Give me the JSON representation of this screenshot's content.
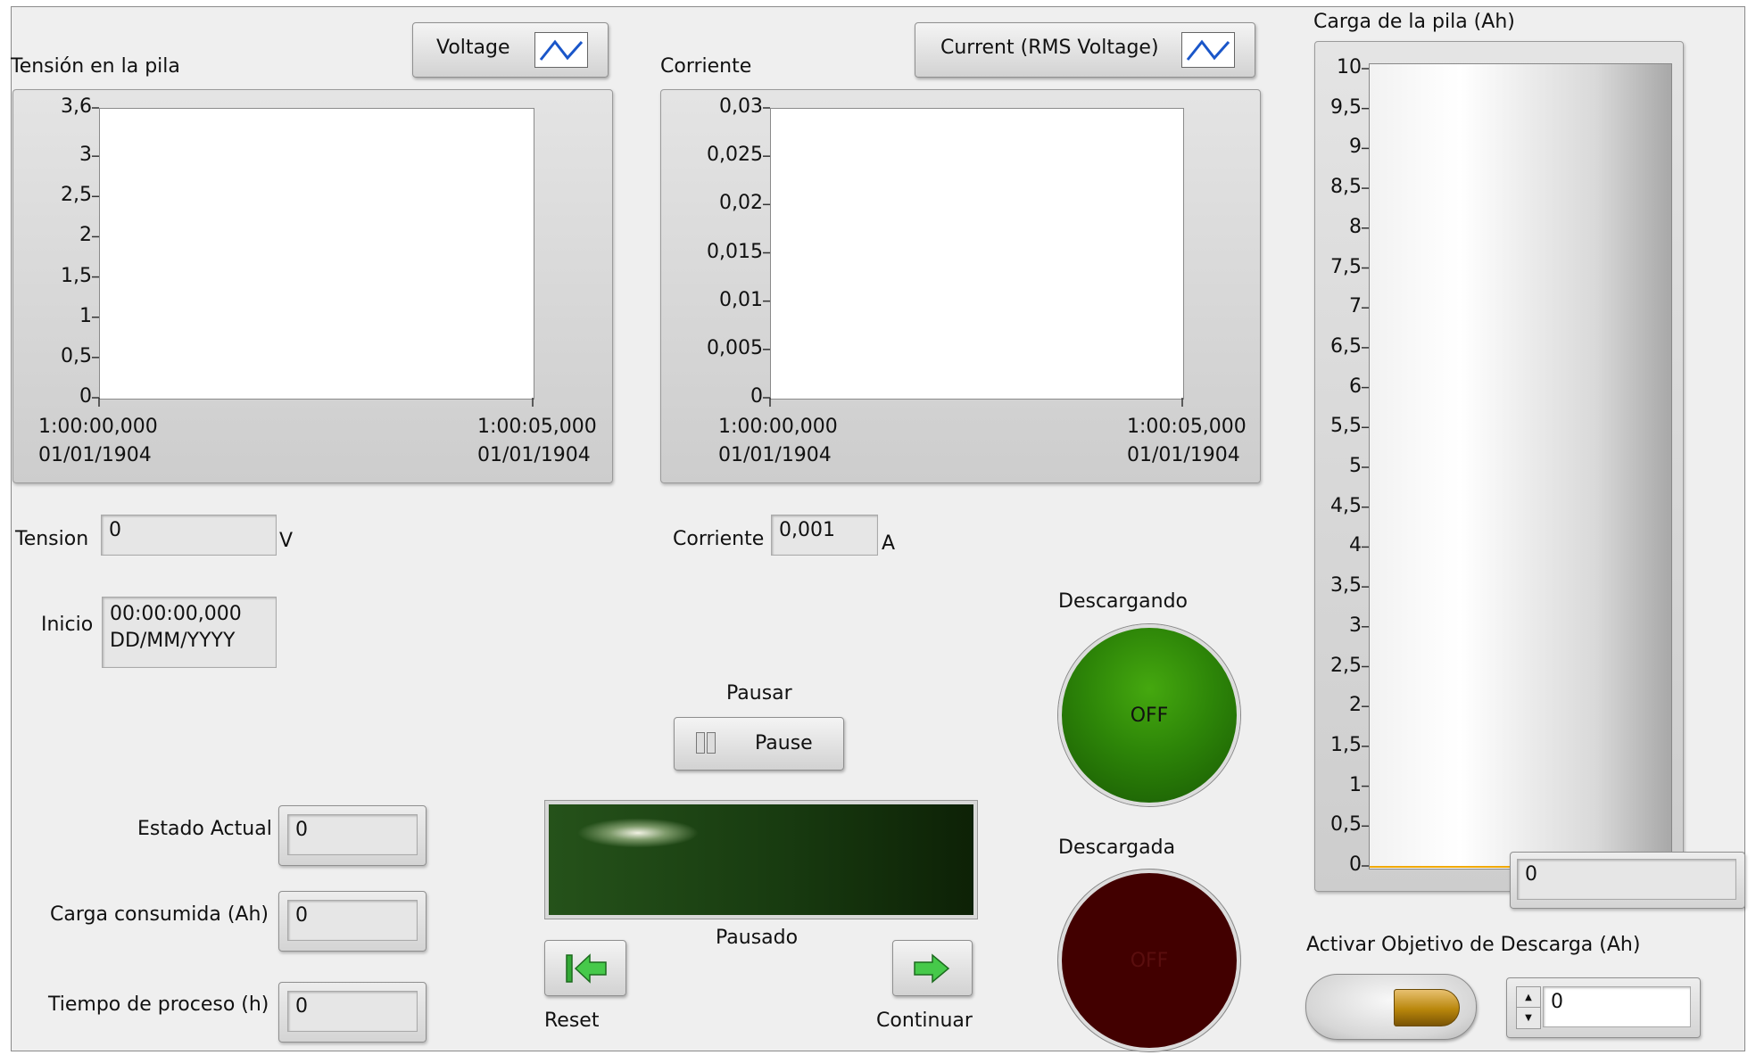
{
  "colors": {
    "panel": "#efefef",
    "led_green": "#2f8f0b",
    "led_red": "#420000",
    "bar_fill": "#f0a800",
    "display_dark": "#1c3a10"
  },
  "voltage_graph": {
    "title": "Tensión en la pila",
    "legend_label": "Voltage",
    "legend_icon": "waveform-icon",
    "y_ticks": [
      "3,6",
      "3",
      "2,5",
      "2",
      "1,5",
      "1",
      "0,5",
      "0"
    ],
    "x_start": "1:00:00,000\n01/01/1904",
    "x_end": "1:00:05,000\n01/01/1904"
  },
  "current_graph": {
    "title": "Corriente",
    "legend_label": "Current (RMS Voltage)",
    "legend_icon": "waveform-icon",
    "y_ticks": [
      "0,03",
      "0,025",
      "0,02",
      "0,015",
      "0,01",
      "0,005",
      "0"
    ],
    "x_start": "1:00:00,000\n01/01/1904",
    "x_end": "1:00:05,000\n01/01/1904"
  },
  "charge_bar": {
    "title": "Carga de la pila (Ah)",
    "ticks": [
      "10",
      "9,5",
      "9",
      "8,5",
      "8",
      "7,5",
      "7",
      "6,5",
      "6",
      "5,5",
      "5",
      "4,5",
      "4",
      "3,5",
      "3",
      "2,5",
      "2",
      "1,5",
      "1",
      "0,5",
      "0"
    ],
    "value": 0,
    "display": "0"
  },
  "tension": {
    "label": "Tension",
    "value": "0",
    "unit": "V"
  },
  "corriente": {
    "label": "Corriente",
    "value": "0,001",
    "unit": "A"
  },
  "inicio": {
    "label": "Inicio",
    "value": "00:00:00,000\nDD/MM/YYYY"
  },
  "descargando": {
    "label": "Descargando",
    "state": "OFF"
  },
  "descargada": {
    "label": "Descargada",
    "state": "OFF"
  },
  "pausar": {
    "label": "Pausar",
    "button": "Pause"
  },
  "status_display": {
    "label": "Pausado"
  },
  "reset": {
    "label": "Reset",
    "icon": "skip-back-icon"
  },
  "continuar": {
    "label": "Continuar",
    "icon": "arrow-right-icon"
  },
  "estado_actual": {
    "label": "Estado Actual",
    "value": "0"
  },
  "carga_consumida": {
    "label": "Carga consumida (Ah)",
    "value": "0"
  },
  "tiempo_proceso": {
    "label": "Tiempo de proceso (h)",
    "value": "0"
  },
  "objetivo": {
    "label": "Activar Objetivo de Descarga (Ah)",
    "value": "0",
    "switch_on": false
  }
}
